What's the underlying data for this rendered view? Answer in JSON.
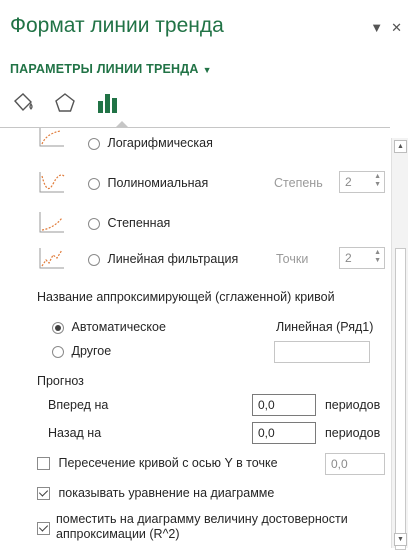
{
  "header": {
    "title": "Формат линии тренда",
    "subtitle": "ПАРАМЕТРЫ ЛИНИИ ТРЕНДА",
    "pin_icon": "dropdown-arrow-icon",
    "close_icon": "close-icon"
  },
  "tabs": [
    {
      "name": "fill-line-tab",
      "icon": "paint-bucket-icon"
    },
    {
      "name": "effects-tab",
      "icon": "pentagon-icon"
    },
    {
      "name": "trendline-options-tab",
      "icon": "bar-chart-icon",
      "active": true
    }
  ],
  "trend_types": {
    "log": {
      "label": "Логарифмическая"
    },
    "poly": {
      "label": "Полиномиальная",
      "degree_label": "Степень",
      "degree_value": "2"
    },
    "power": {
      "label": "Степенная"
    },
    "moving": {
      "label": "Линейная фильтрация",
      "points_label": "Точки",
      "points_value": "2"
    }
  },
  "name_section": {
    "heading": "Название аппроксимирующей (сглаженной) кривой",
    "auto_label": "Автоматическое",
    "auto_value": "Линейная (Ряд1)",
    "custom_label": "Другое",
    "custom_value": ""
  },
  "forecast": {
    "heading": "Прогноз",
    "forward_label": "Вперед на",
    "forward_value": "0,0",
    "backward_label": "Назад на",
    "backward_value": "0,0",
    "periods_label": "периодов"
  },
  "options": {
    "intercept_label": "Пересечение кривой с осью Y в точке",
    "intercept_value": "0,0",
    "show_equation_label": "показывать уравнение на диаграмме",
    "show_r2_label_line1": "поместить на диаграмму величину достоверности",
    "show_r2_label_line2": "аппроксимации (R^2)"
  },
  "colors": {
    "accent": "#217346",
    "chart_icon": "#217346",
    "trend_line": "#e07b39"
  }
}
